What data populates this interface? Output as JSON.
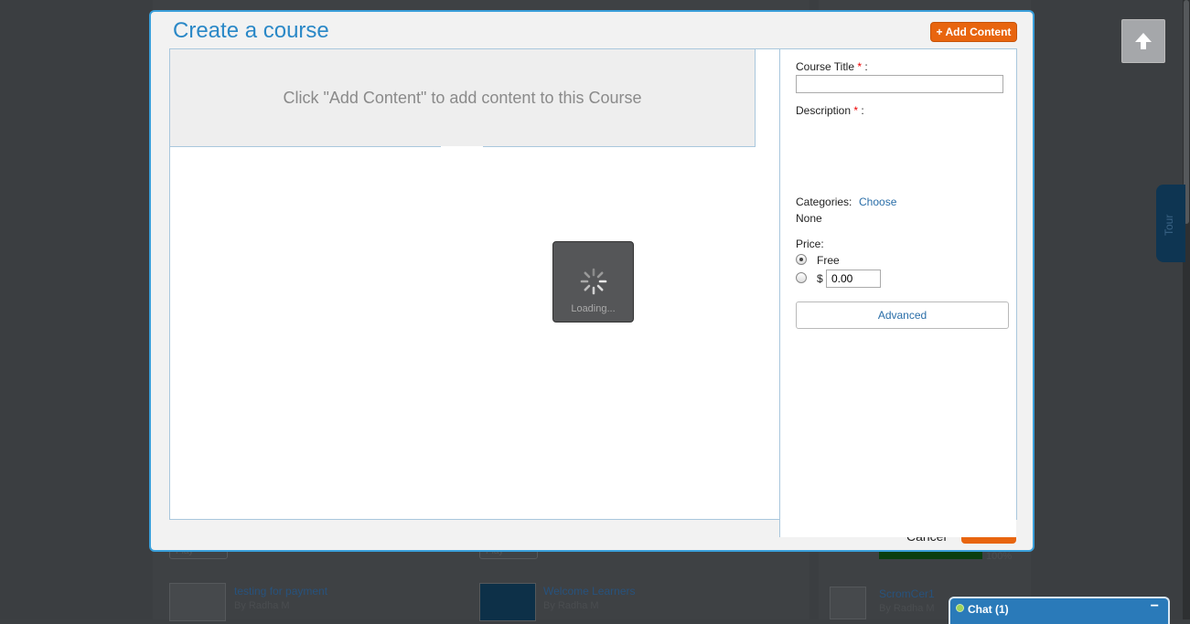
{
  "background": {
    "cards": [
      {
        "title": "testing for payment",
        "byline": "By Radha M"
      },
      {
        "title": "Welcome Learners",
        "byline": "By Radha M"
      }
    ],
    "side_item": {
      "title": "ScromCer1",
      "byline": "By Radha M",
      "progress_label": "100%"
    },
    "play_label": "Play",
    "tour_label": "Tour"
  },
  "modal": {
    "title": "Create a course",
    "add_content_label": "+ Add Content",
    "placeholder_text": "Click \"Add Content\" to add content to this Course",
    "loading_text": "Loading...",
    "cancel_label": "Cancel"
  },
  "form": {
    "course_title_label": "Course Title",
    "required_mark": "*",
    "colon": " :",
    "course_title_value": "",
    "description_label": "Description",
    "categories_label": "Categories:",
    "choose_label": "Choose",
    "categories_value": "None",
    "price_label": "Price:",
    "free_label": "Free",
    "currency_symbol": "$",
    "price_value": "0.00",
    "selected_price_option": "Free",
    "advanced_label": "Advanced"
  },
  "chat": {
    "label": "Chat",
    "count": "(1)",
    "minimize_symbol": "−"
  },
  "colors": {
    "accent_orange": "#e8650f",
    "modal_border": "#3a9fda",
    "title_blue": "#2a88c7",
    "chat_blue": "#2a7ab9"
  }
}
